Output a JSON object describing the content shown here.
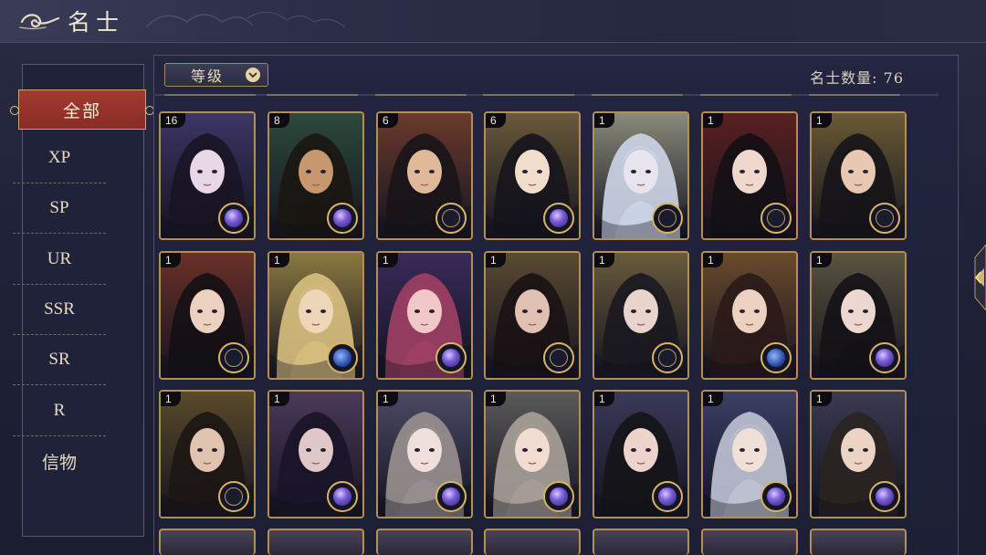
{
  "header": {
    "title": "名士"
  },
  "sidebar": {
    "active": "全部",
    "items": [
      "XP",
      "SP",
      "UR",
      "SSR",
      "SR",
      "R",
      "信物"
    ]
  },
  "toolbar": {
    "sort_label": "等级",
    "count_label": "名士数量: 76"
  },
  "cards": [
    {
      "level": "16",
      "palette": [
        "#3d3566",
        "#e8d8e6",
        "#1a1424"
      ],
      "emblem": "orb"
    },
    {
      "level": "8",
      "palette": [
        "#2c4a3a",
        "#c79770",
        "#1b1612"
      ],
      "emblem": "orb"
    },
    {
      "level": "6",
      "palette": [
        "#6b3a2c",
        "#e0b99a",
        "#181418"
      ],
      "emblem": "compass"
    },
    {
      "level": "6",
      "palette": [
        "#6a5a3a",
        "#f0ddcc",
        "#16141c"
      ],
      "emblem": "orb"
    },
    {
      "level": "1",
      "palette": [
        "#8a8a7a",
        "#e8e4ee",
        "#cdd6e8"
      ],
      "emblem": "compass"
    },
    {
      "level": "1",
      "palette": [
        "#5a2020",
        "#f0d8cc",
        "#141016"
      ],
      "emblem": "compass"
    },
    {
      "level": "1",
      "palette": [
        "#6a5a34",
        "#e8c8b0",
        "#16141a"
      ],
      "emblem": "compass"
    },
    {
      "level": "1",
      "palette": [
        "#6a3028",
        "#ecd0c0",
        "#141014"
      ],
      "emblem": "compass"
    },
    {
      "level": "1",
      "palette": [
        "#8a7840",
        "#f0d6b8",
        "#d8c080"
      ],
      "emblem": "blue"
    },
    {
      "level": "1",
      "palette": [
        "#3a2a5a",
        "#f0c8c8",
        "#a04064"
      ],
      "emblem": "orb"
    },
    {
      "level": "1",
      "palette": [
        "#5a4a30",
        "#e0c0b0",
        "#1a1214"
      ],
      "emblem": "compass"
    },
    {
      "level": "1",
      "palette": [
        "#6a5a3c",
        "#e8d4cc",
        "#1a1820"
      ],
      "emblem": "compass"
    },
    {
      "level": "1",
      "palette": [
        "#6a4a2c",
        "#ecd0c0",
        "#2a1a18"
      ],
      "emblem": "blue"
    },
    {
      "level": "1",
      "palette": [
        "#5a5440",
        "#ecd8d0",
        "#141216"
      ],
      "emblem": "orb"
    },
    {
      "level": "1",
      "palette": [
        "#5a4a2a",
        "#e0c4b0",
        "#1c1614"
      ],
      "emblem": "compass"
    },
    {
      "level": "1",
      "palette": [
        "#4a3a5a",
        "#e0c8c8",
        "#1a1428"
      ],
      "emblem": "orb"
    },
    {
      "level": "1",
      "palette": [
        "#4a4a64",
        "#f0e0dc",
        "#9a9090"
      ],
      "emblem": "orb"
    },
    {
      "level": "1",
      "palette": [
        "#5a5a5a",
        "#f0dcd0",
        "#a8a098"
      ],
      "emblem": "orb"
    },
    {
      "level": "1",
      "palette": [
        "#3a3a5a",
        "#ecd4cc",
        "#141418"
      ],
      "emblem": "orb"
    },
    {
      "level": "1",
      "palette": [
        "#3a4066",
        "#f0e0d8",
        "#c0c4d4"
      ],
      "emblem": "orb"
    },
    {
      "level": "1",
      "palette": [
        "#3a3a52",
        "#ecd4c4",
        "#2a2420"
      ],
      "emblem": "orb"
    }
  ]
}
